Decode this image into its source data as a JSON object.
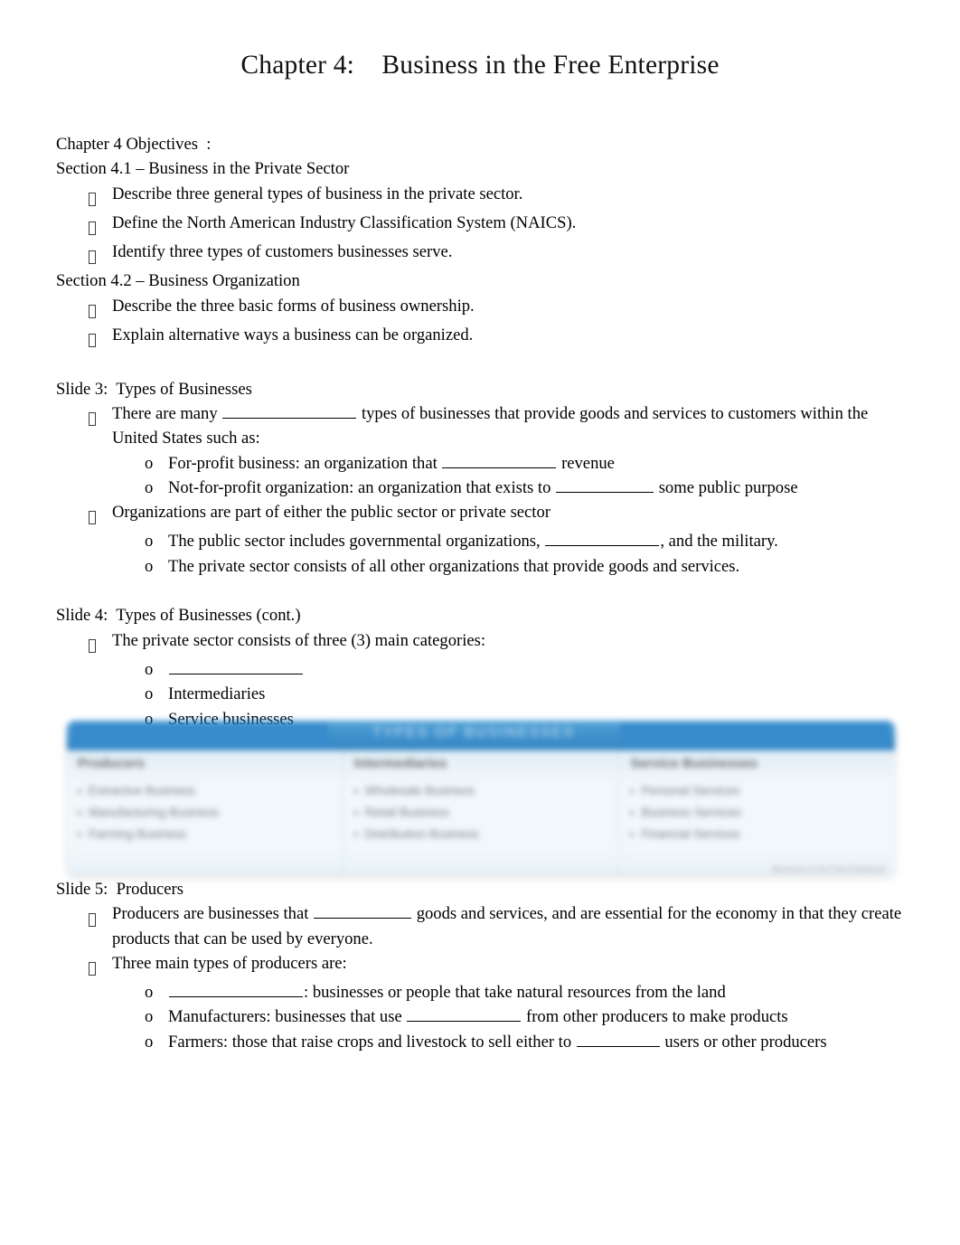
{
  "document": {
    "title": "Chapter 4:    Business in the Free Enterprise"
  },
  "objectives": {
    "heading": "Chapter 4 Objectives  :",
    "section_41": "Section 4.1 – Business in the Private Sector",
    "items_41": [
      "Describe three general types of business in the private sector.",
      "Define the North American Industry Classification System (NAICS).",
      "Identify three types of customers businesses serve."
    ],
    "section_42": "Section 4.2 – Business Organization",
    "items_42": [
      "Describe the three basic forms of business ownership.",
      "Explain alternative ways a business can be organized."
    ]
  },
  "slide3": {
    "heading": "Slide 3:  Types of Businesses",
    "b1_a": "There are many ",
    "b1_b": " types of businesses that provide goods and services to customers within the United States such as:",
    "s1_a": "For-profit business: an organization that ",
    "s1_b": " revenue",
    "s2_a": "Not-for-profit organization: an organization that exists to ",
    "s2_b": " some public purpose",
    "b2": "Organizations are part of either the public sector or private sector",
    "s3_a": "The public sector includes governmental organizations, ",
    "s3_b": ", and the military.",
    "s4": "The private sector consists of all other organizations that provide goods and services."
  },
  "slide4": {
    "heading": "Slide 4:  Types of Businesses (cont.)",
    "b1": "The private sector consists of three (3) main categories:",
    "s1": "",
    "s2": "Intermediaries",
    "s3": "Service businesses"
  },
  "table_figure": {
    "banner_title": "TYPES OF BUSINESSES",
    "columns": [
      {
        "header": "Producers",
        "items": [
          "Extractive Business",
          "Manufacturing Business",
          "Farming Business"
        ]
      },
      {
        "header": "Intermediaries",
        "items": [
          "Wholesale Business",
          "Retail Business",
          "Distribution Business"
        ]
      },
      {
        "header": "Service Businesses",
        "items": [
          "Personal Services",
          "Business Services",
          "Financial Services"
        ]
      }
    ],
    "credit": "Business in the Free Enterprise"
  },
  "slide5": {
    "heading": "Slide 5:  Producers",
    "b1_a": "Producers are businesses that ",
    "b1_b": " goods and services, and are essential for the economy in that they create products that can be used by everyone.",
    "b2": "Three main types of producers are:",
    "s1_a": "",
    "s1_b": ": businesses or people that take natural resources from the land",
    "s2_a": "Manufacturers: businesses that use ",
    "s2_b": " from other producers to make products",
    "s3_a": "Farmers: those that raise crops and livestock to sell either to ",
    "s3_b": " users or other producers"
  },
  "colors": {
    "table_header_blue": "#0b72bf",
    "table_body_tint": "#eef5fa",
    "text": "#000000"
  }
}
